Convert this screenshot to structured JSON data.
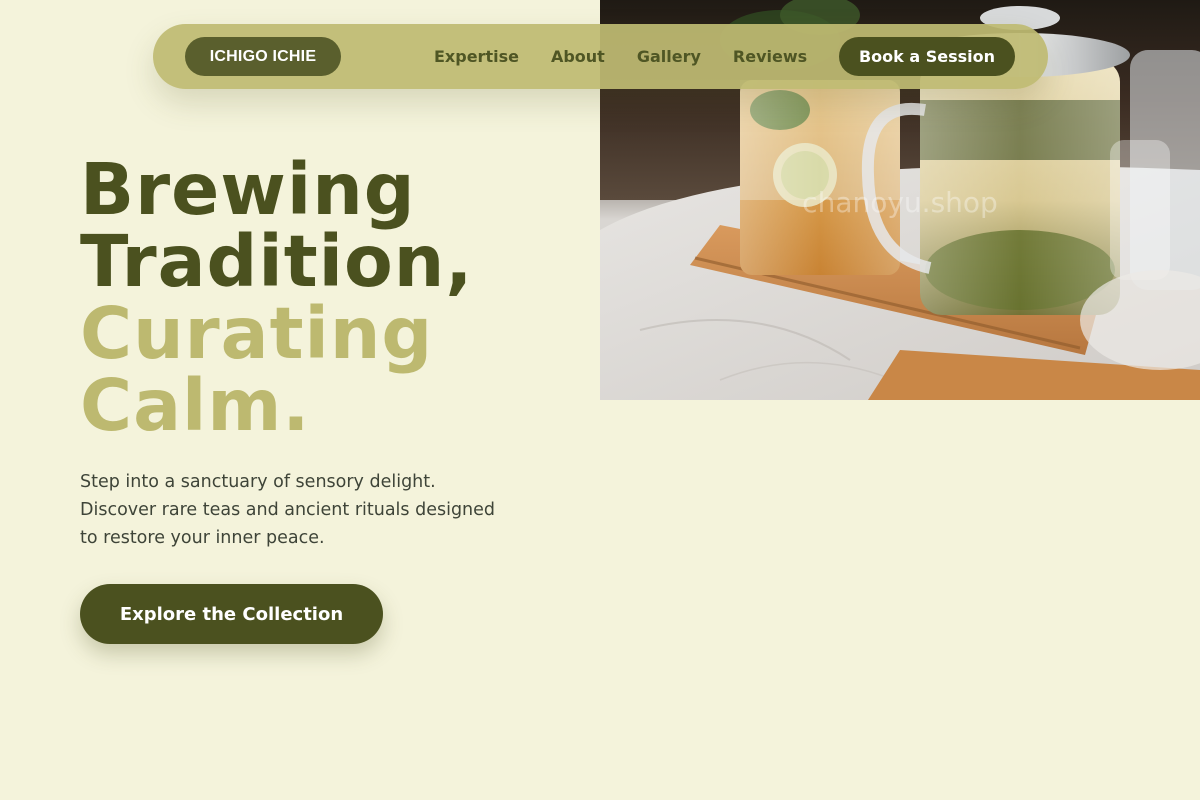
{
  "brand": {
    "label": "ICHIGO ICHIE"
  },
  "nav": {
    "links": [
      {
        "label": "Expertise"
      },
      {
        "label": "About"
      },
      {
        "label": "Gallery"
      },
      {
        "label": "Reviews"
      }
    ],
    "cta_label": "Book a Session"
  },
  "hero": {
    "headline_dark": [
      "Brewing",
      "Tradition,"
    ],
    "headline_light": [
      "Curating",
      "Calm."
    ],
    "lede_lines": [
      "Step into a sanctuary of sensory delight.",
      "Discover rare teas and ancient rituals designed",
      "to restore your inner peace."
    ],
    "cta_label": "Explore the Collection",
    "image_watermark": "chanoyu.shop"
  },
  "colors": {
    "background": "#f4f3db",
    "accent_dark": "#4b511f",
    "accent_light": "#bdb970",
    "nav_bg": "#bebA72"
  }
}
